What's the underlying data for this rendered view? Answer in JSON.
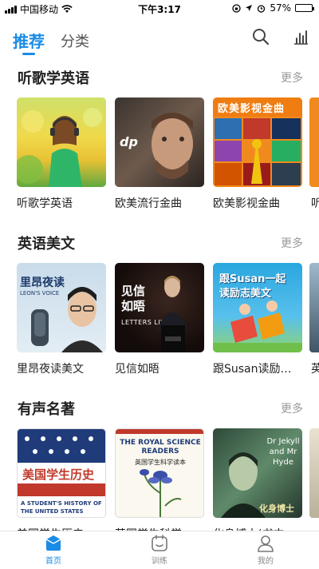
{
  "status_bar": {
    "carrier": "中国移动",
    "time": "下午3:17",
    "battery": "57%",
    "battery_level": 0.57
  },
  "header": {
    "tabs": [
      {
        "label": "推荐",
        "active": true
      },
      {
        "label": "分类",
        "active": false
      }
    ],
    "icons": [
      "search-icon",
      "chart-icon"
    ]
  },
  "sections": [
    {
      "title": "听歌学英语",
      "more": "更多",
      "items": [
        {
          "label": "听歌学英语",
          "cover_text": ""
        },
        {
          "label": "欧美流行金曲",
          "cover_text": "dp"
        },
        {
          "label": "欧美影视金曲",
          "cover_text": "欧美影视金曲"
        },
        {
          "label": "听"
        }
      ]
    },
    {
      "title": "英语美文",
      "more": "更多",
      "items": [
        {
          "label": "里昂夜读美文",
          "cover_text": "里昂夜读",
          "cover_sub": "LEON'S VOICE"
        },
        {
          "label": "见信如晤",
          "cover_text": "见信 如晤",
          "cover_sub": "LETTERS LIVE"
        },
        {
          "label": "跟Susan读励…",
          "cover_text": "跟Susan一起 读励志美文"
        },
        {
          "label": "英"
        }
      ]
    },
    {
      "title": "有声名著",
      "more": "更多",
      "items": [
        {
          "label": "美国学生历史…",
          "cover_text": "美国学生历史",
          "cover_sub": "A STUDENT'S HISTORY OF THE UNITED STATES"
        },
        {
          "label": "英国学生科学…",
          "cover_text": "THE ROYAL SCIENCE READERS",
          "cover_sub": "英国学生科学读本"
        },
        {
          "label": "化身博士(书中…",
          "cover_text": "Dr Jekyll and Mr Hyde",
          "cover_sub": "化身博士"
        }
      ]
    }
  ],
  "bottom_nav": [
    {
      "label": "首页",
      "icon": "home-icon",
      "active": true
    },
    {
      "label": "训练",
      "icon": "training-icon",
      "active": false
    },
    {
      "label": "我的",
      "icon": "profile-icon",
      "active": false
    }
  ],
  "colors": {
    "accent": "#1a8ce6",
    "muted": "#999999"
  }
}
